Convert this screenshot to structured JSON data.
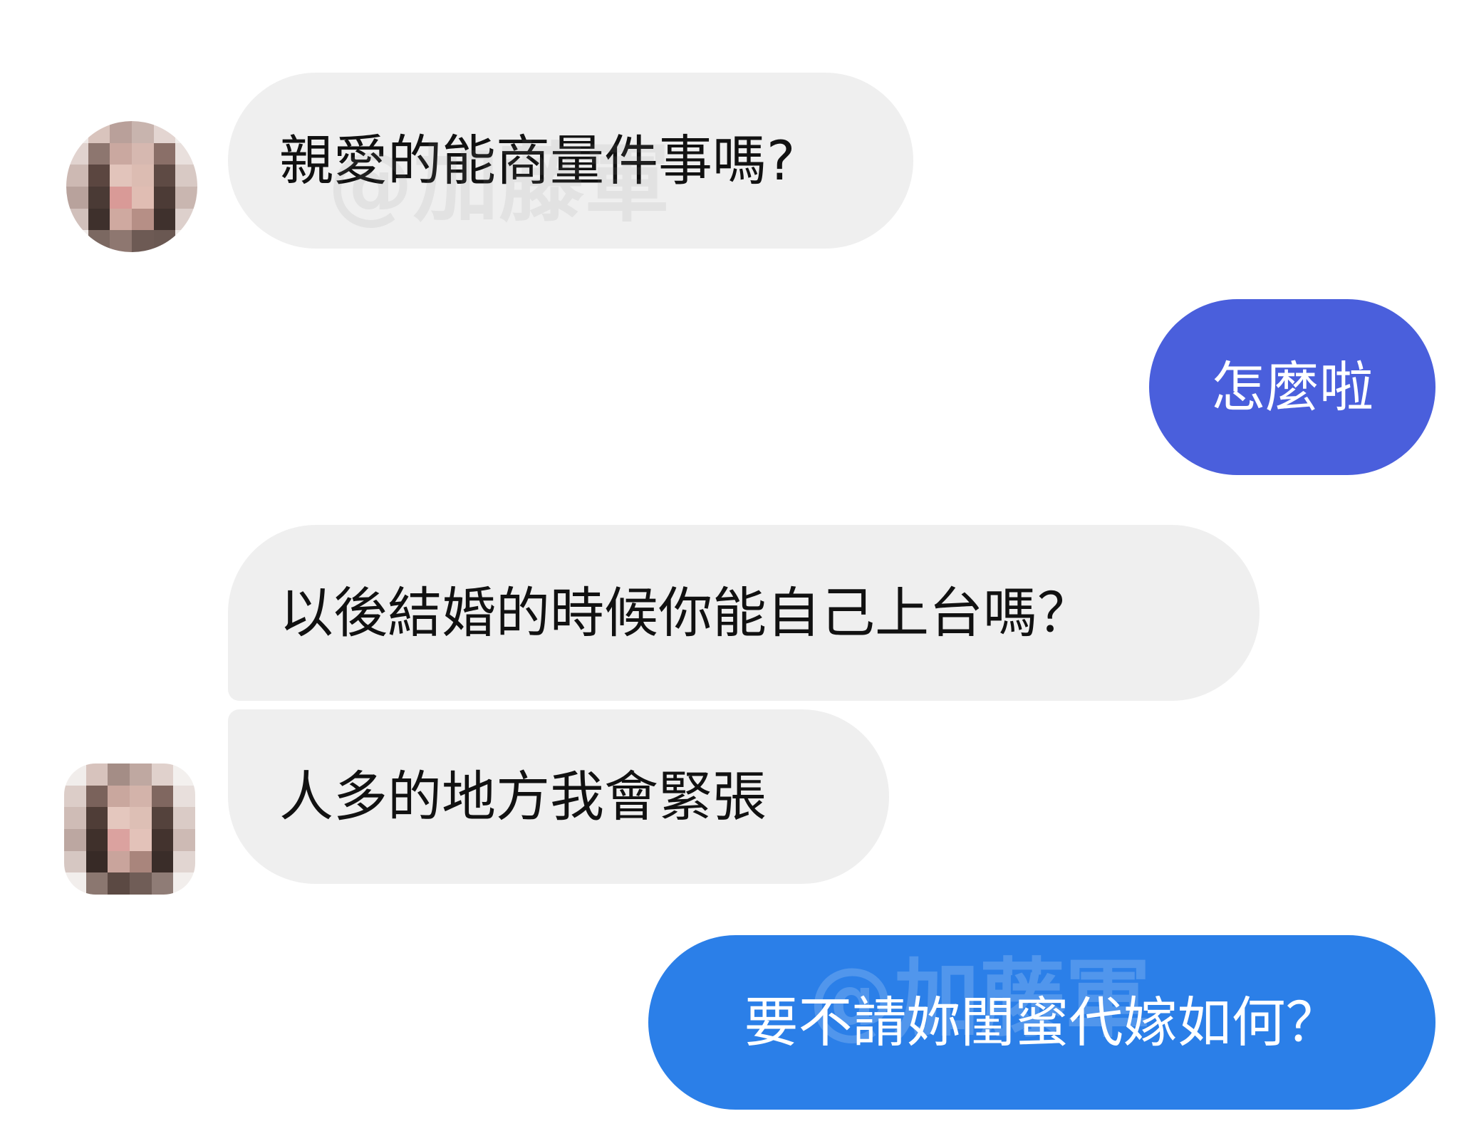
{
  "conversation": {
    "messages": [
      {
        "sender": "contact",
        "text": "親愛的能商量件事嗎?"
      },
      {
        "sender": "me",
        "text": "怎麼啦"
      },
      {
        "sender": "contact",
        "text": "以後結婚的時候你能自己上台嗎？"
      },
      {
        "sender": "contact",
        "text": "人多的地方我會緊張"
      },
      {
        "sender": "me",
        "text": "要不請妳閨蜜代嫁如何？"
      }
    ]
  },
  "watermark": {
    "text": "@加藤軍"
  },
  "colors": {
    "received_bubble": "#efefef",
    "sent_bubble_1": "#4a5fdc",
    "sent_bubble_2": "#2b7fe8",
    "page_background": "#ffffff"
  }
}
